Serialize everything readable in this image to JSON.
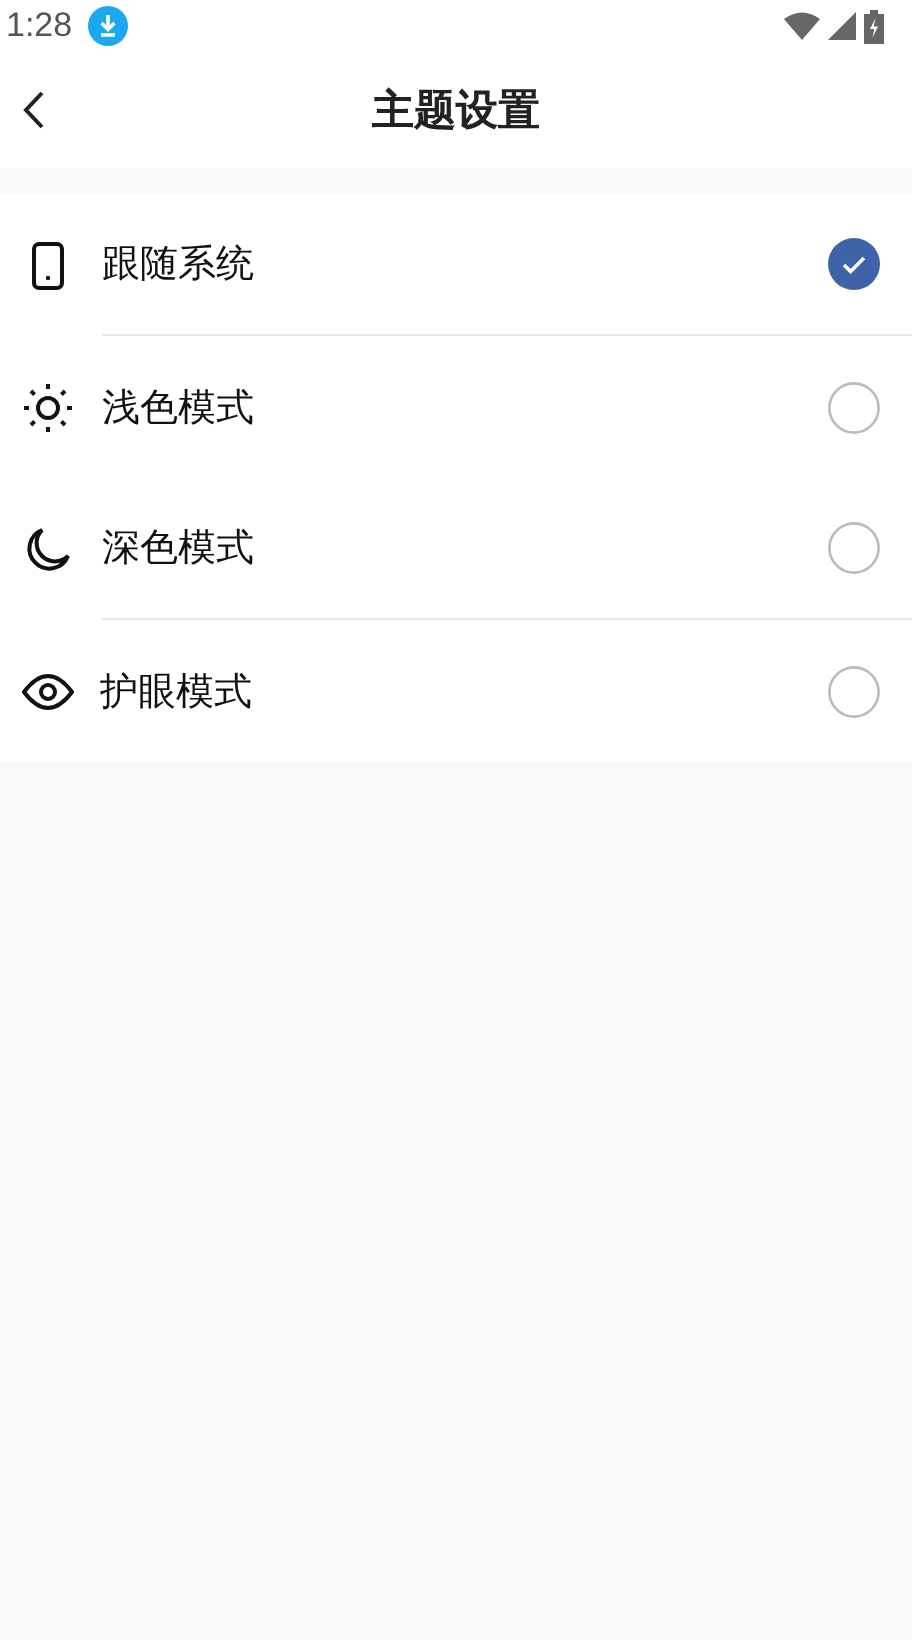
{
  "status_bar": {
    "time": "1:28"
  },
  "header": {
    "title": "主题设置"
  },
  "options": [
    {
      "kind": "phone",
      "label": "跟随系统",
      "selected": true,
      "divider": true
    },
    {
      "kind": "sun",
      "label": "浅色模式",
      "selected": false,
      "divider": false
    },
    {
      "kind": "moon",
      "label": "深色模式",
      "selected": false,
      "divider": true
    },
    {
      "kind": "eye",
      "label": "护眼模式",
      "selected": false,
      "divider": false
    }
  ]
}
